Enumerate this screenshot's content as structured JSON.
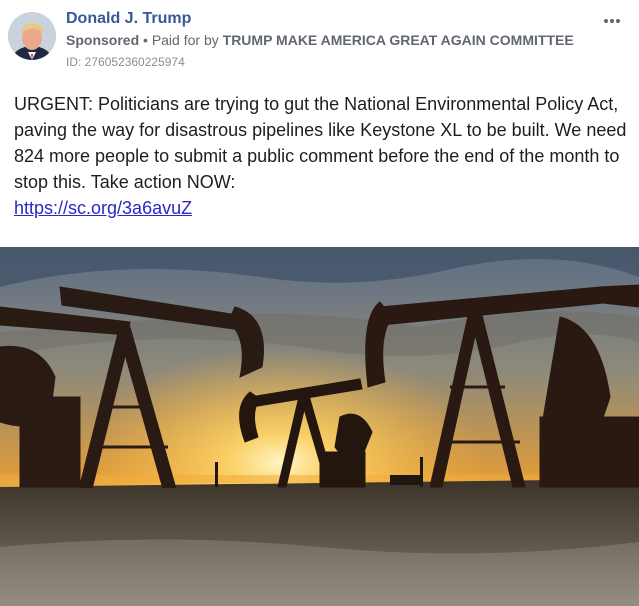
{
  "post": {
    "author": "Donald J. Trump",
    "sponsored_label": "Sponsored",
    "separator": " • ",
    "paid_for_prefix": "Paid for by ",
    "paid_for_by": "TRUMP MAKE AMERICA GREAT AGAIN COMMITTEE",
    "ad_id": "ID: 276052360225974",
    "body": "URGENT: Politicians are trying to gut the National Environmental Policy Act, paving the way for disastrous pipelines like Keystone XL to be built. We need 824 more people to submit a public comment before the end of the month to stop this. Take action NOW:",
    "link": "https://sc.org/3a6avuZ"
  },
  "icons": {
    "more": "more-options-icon"
  },
  "colors": {
    "author": "#385898",
    "link": "#2d26c8",
    "meta": "#606770",
    "text": "#1c1e21"
  }
}
